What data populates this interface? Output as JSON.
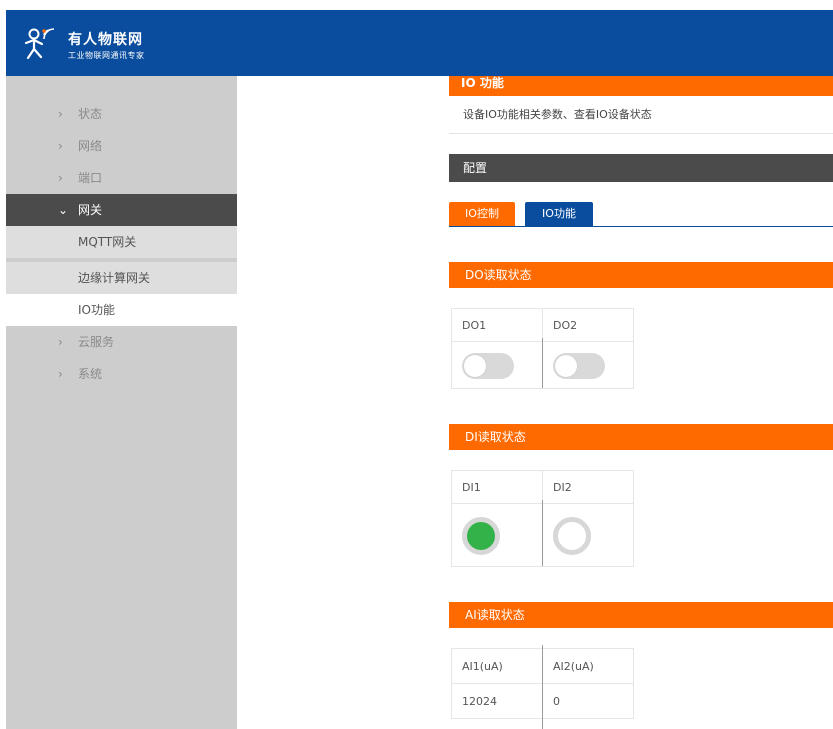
{
  "header": {
    "brand_title": "有人物联网",
    "brand_subtitle": "工业物联网通讯专家",
    "logo_icon": "person-signal-logo-icon"
  },
  "sidebar": {
    "items": [
      {
        "label": "状态",
        "chevron": "›"
      },
      {
        "label": "网络",
        "chevron": "›"
      },
      {
        "label": "端口",
        "chevron": "›"
      },
      {
        "label": "网关",
        "chevron": "⌄",
        "expanded": true
      },
      {
        "label": "云服务",
        "chevron": "›"
      },
      {
        "label": "系统",
        "chevron": "›"
      }
    ],
    "sub_items": [
      {
        "label": "MQTT网关"
      },
      {
        "label": "边缘计算网关"
      },
      {
        "label": "IO功能"
      }
    ]
  },
  "main": {
    "title": "IO 功能",
    "description": "设备IO功能相关参数、查看IO设备状态",
    "config_label": "配置",
    "tabs": [
      {
        "label": "IO控制"
      },
      {
        "label": "IO功能"
      }
    ],
    "do_section": {
      "title": "DO读取状态",
      "channels": [
        {
          "label": "DO1",
          "state": "off"
        },
        {
          "label": "DO2",
          "state": "off"
        }
      ]
    },
    "di_section": {
      "title": "DI读取状态",
      "channels": [
        {
          "label": "DI1",
          "state": "on"
        },
        {
          "label": "DI2",
          "state": "off"
        }
      ]
    },
    "ai_section": {
      "title": "AI读取状态",
      "channels": [
        {
          "label": "AI1(uA)",
          "value": "12024"
        },
        {
          "label": "AI2(uA)",
          "value": "0"
        }
      ]
    }
  },
  "colors": {
    "header_blue": "#0a4d9e",
    "accent_orange": "#ff6a00",
    "dark_bar": "#4b4b4b",
    "sidebar_bg": "#cdcdcd",
    "indicator_green": "#33b249"
  }
}
